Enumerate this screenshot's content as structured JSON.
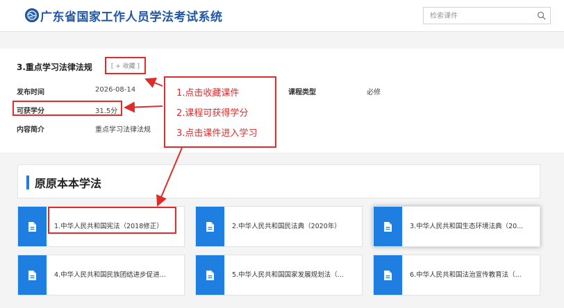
{
  "header": {
    "site_title": "广东省国家工作人员学法考试系统",
    "logo_icon": "globe-logo-icon",
    "search_placeholder": "检索课件",
    "search_icon": "search-icon"
  },
  "course": {
    "title": "3.重点学习法律法规",
    "favorite_label": "[ + 收藏 ]",
    "fields": {
      "publish_time_label": "发布时间",
      "publish_time_value": "2026-08-14",
      "credit_label": "可获学分",
      "credit_value": "31.5分",
      "summary_label": "内容简介",
      "summary_value": "重点学习法律法规",
      "type_label": "课程类型",
      "type_value": "必修"
    }
  },
  "annotations": [
    "1.点击收藏课件",
    "2.课程可获得学分",
    "3.点击课件进入学习"
  ],
  "section": {
    "title": "原原本本学法"
  },
  "courseware": [
    {
      "title": "1.中华人民共和国宪法（2018修正）"
    },
    {
      "title": "2.中华人民共和国民法典（2020年）"
    },
    {
      "title": "3.中华人民共和国生态环境法典（20..."
    },
    {
      "title": "4.中华人民共和国民族团结进步促进..."
    },
    {
      "title": "5.中华人民共和国国家发展规划法（..."
    },
    {
      "title": "6.中华人民共和国法治宣传教育法（..."
    }
  ],
  "colors": {
    "brand_blue": "#1f56a6",
    "accent_blue": "#1f7fe0",
    "annotation_red": "#e02b2b"
  }
}
